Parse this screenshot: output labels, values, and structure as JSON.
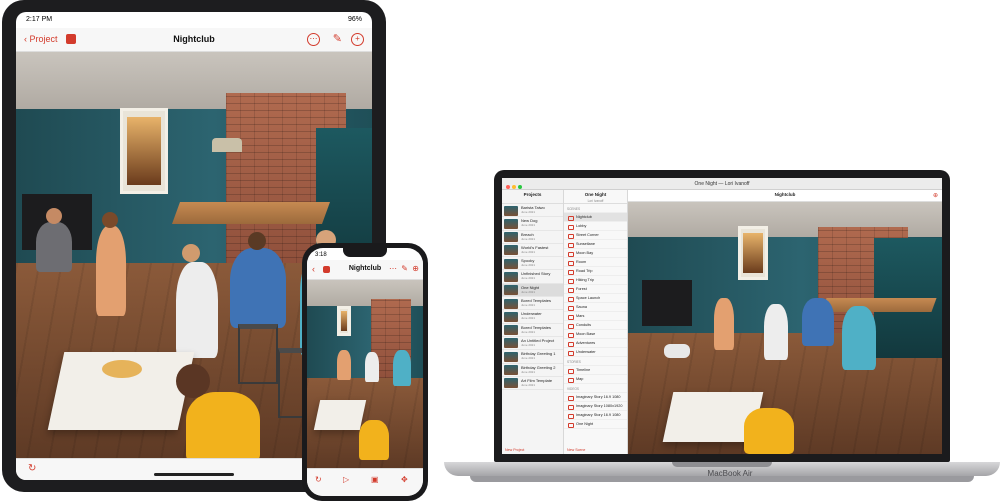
{
  "ipad": {
    "status_time": "2:17 PM",
    "status_right": "96%",
    "back_label": "Project",
    "title": "Nightclub"
  },
  "iphone": {
    "status_time": "3:18",
    "title": "Nightclub"
  },
  "mac": {
    "window_title": "One Night — Lori Ivanoff",
    "col1_title": "Projects",
    "col2_title": "One Night",
    "col2_subtitle": "Lori Ivanoff",
    "col3_title": "Nightclub",
    "projects": [
      {
        "name": "Barista Taiwo",
        "date": "June 2021"
      },
      {
        "name": "New Dog",
        "date": "June 2021"
      },
      {
        "name": "Breach",
        "date": "June 2021"
      },
      {
        "name": "World's Fastest",
        "date": "June 2021"
      },
      {
        "name": "Spooky",
        "date": "June 2021"
      },
      {
        "name": "Unfinished Story",
        "date": "June 2021"
      },
      {
        "name": "One Night",
        "date": "June 2021"
      },
      {
        "name": "Bored Templates",
        "date": "June 2021"
      },
      {
        "name": "Underwater",
        "date": "June 2021"
      },
      {
        "name": "Bored Templates",
        "date": "June 2021"
      },
      {
        "name": "An Untitled Project",
        "date": "June 2021"
      },
      {
        "name": "Birthday Greeting 1",
        "date": "June 2021"
      },
      {
        "name": "Birthday Greeting 2",
        "date": "June 2021"
      },
      {
        "name": "Art Film Template",
        "date": "June 2021"
      }
    ],
    "sections": {
      "scenes": "SCENES",
      "stories": "STORIES",
      "videos": "VIDEOS"
    },
    "scenes": [
      "Nightclub",
      "Lobby",
      "Street Corner",
      "Sunsetlane",
      "Moon Bay",
      "Room",
      "Road Trip",
      "Hiking Trip",
      "Forest",
      "Space Launch",
      "Sauna",
      "Mars",
      "Conduits",
      "Moon Base",
      "Adventures",
      "Underwater"
    ],
    "stories": [
      "Timeline",
      "Map"
    ],
    "videos": [
      "Imaginary Story 16.9 1080",
      "Imaginary Story 1080x1920",
      "Imaginary Story 16.9 1080",
      "One Night"
    ],
    "new_project": "New Project",
    "new_scene": "New Scene",
    "brand": "MacBook Air"
  },
  "colors": {
    "accent": "#d33b2c",
    "wall": "#2c6470",
    "floor": "#6b4a33"
  }
}
